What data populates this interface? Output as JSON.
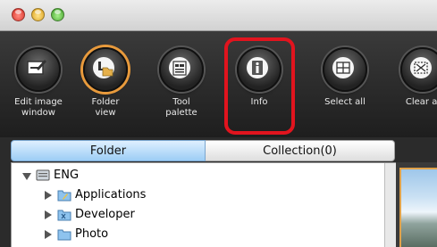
{
  "toolbar": {
    "items": [
      {
        "label": "Edit image\nwindow",
        "icon": "edit-image-icon"
      },
      {
        "label": "Folder\nview",
        "icon": "folder-view-icon"
      },
      {
        "label": "Tool\npalette",
        "icon": "tool-palette-icon"
      },
      {
        "label": "Info",
        "icon": "info-icon"
      },
      {
        "label": "Select all",
        "icon": "select-all-icon"
      },
      {
        "label": "Clear al",
        "icon": "clear-all-icon"
      }
    ],
    "highlight_color": "#e1141e"
  },
  "tabs": {
    "folder": "Folder",
    "collection": "Collection(0)"
  },
  "tree": {
    "root": "ENG",
    "children": [
      "Applications",
      "Developer",
      "Photo"
    ]
  },
  "colors": {
    "tab_active": "#9ccdf5",
    "selected_ring": "#e89a3c"
  }
}
